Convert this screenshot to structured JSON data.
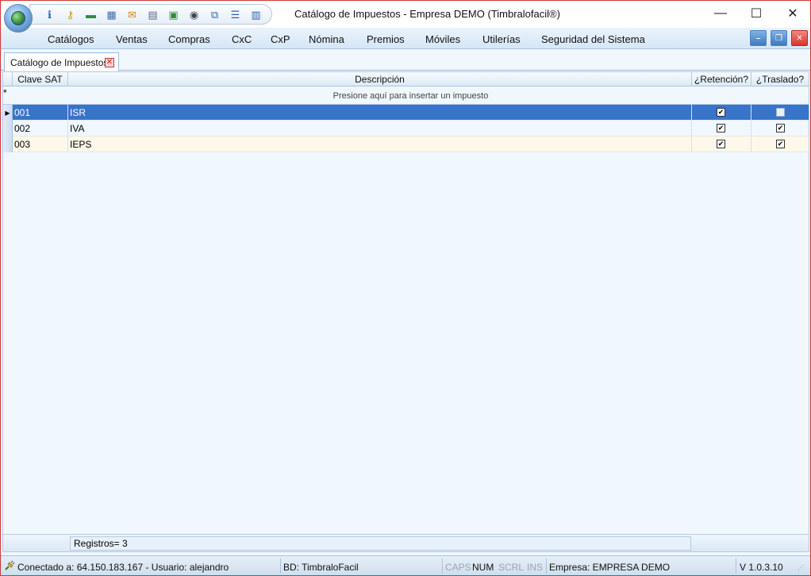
{
  "window": {
    "title": "Catálogo de Impuestos - Empresa DEMO (Timbralofacil®)",
    "minimize_glyph": "—",
    "maximize_glyph": "☐",
    "close_glyph": "✕"
  },
  "quick_access": {
    "icons": [
      "info-icon",
      "key-icon",
      "money-icon",
      "calculator-icon",
      "mail-icon",
      "documents-icon",
      "image-icon",
      "eye-icon",
      "cascade-windows-icon",
      "tile-horizontal-icon",
      "tile-vertical-icon"
    ],
    "glyphs": [
      "ℹ",
      "⚷",
      "▬",
      "▦",
      "✉",
      "▤",
      "▣",
      "◉",
      "⧉",
      "☰",
      "▥"
    ]
  },
  "menu": {
    "items": [
      "Catálogos",
      "Ventas",
      "Compras",
      "CxC",
      "CxP",
      "Nómina",
      "Premios",
      "Móviles",
      "Utilerías",
      "Seguridad del Sistema"
    ]
  },
  "mdi_controls": {
    "minimize": "–",
    "restore": "❐",
    "close": "✕"
  },
  "tab": {
    "label": "Catálogo de Impuestos",
    "close_glyph": "✕"
  },
  "grid": {
    "columns": [
      "Clave SAT",
      "Descripción",
      "¿Retención?",
      "¿Traslado?"
    ],
    "new_row_hint": "Presione aquí para insertar un impuesto",
    "new_row_marker": "*",
    "current_row_marker": "▶",
    "rows": [
      {
        "clave": "001",
        "descripcion": "ISR",
        "retencion": true,
        "traslado": false
      },
      {
        "clave": "002",
        "descripcion": "IVA",
        "retencion": true,
        "traslado": true
      },
      {
        "clave": "003",
        "descripcion": "IEPS",
        "retencion": true,
        "traslado": true
      }
    ],
    "check_glyph": "✔",
    "footer": "Registros= 3"
  },
  "statusbar": {
    "connection": "Conectado a: 64.150.183.167 - Usuario: alejandro",
    "database": "BD: TimbraloFacil",
    "caps": "CAPS",
    "num": "NUM",
    "scrl": "SCRL",
    "ins": "INS",
    "company": "Empresa: EMPRESA DEMO",
    "version": "V 1.0.3.10"
  },
  "colors": {
    "selection": "#3874c8",
    "accent": "#4d84c0",
    "close_red": "#d9342b",
    "alt_row": "#fdf8ea"
  }
}
